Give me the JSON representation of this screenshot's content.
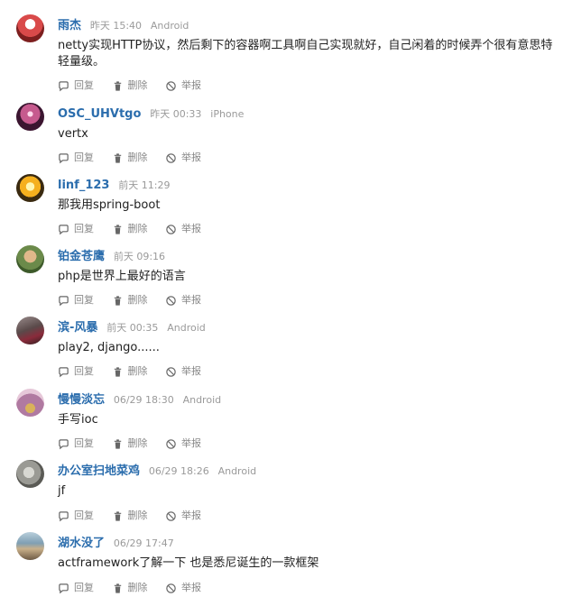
{
  "actions": {
    "reply": "回复",
    "delete": "删除",
    "report": "举报"
  },
  "comments": [
    {
      "author": "雨杰",
      "time": "昨天 15:40",
      "device": "Android",
      "content": "netty实现HTTP协议，然后剩下的容器啊工具啊自己实现就好，自己闲着的时候弄个很有意思特轻量级。"
    },
    {
      "author": "OSC_UHVtgo",
      "time": "昨天 00:33",
      "device": "iPhone",
      "content": "vertx"
    },
    {
      "author": "linf_123",
      "time": "前天 11:29",
      "device": "",
      "content": "那我用spring-boot"
    },
    {
      "author": "铂金苍鹰",
      "time": "前天 09:16",
      "device": "",
      "content": "php是世界上最好的语言"
    },
    {
      "author": "滨-风暴",
      "time": "前天 00:35",
      "device": "Android",
      "content": "play2, django......"
    },
    {
      "author": "慢慢淡忘",
      "time": "06/29 18:30",
      "device": "Android",
      "content": "手写ioc"
    },
    {
      "author": "办公室扫地菜鸡",
      "time": "06/29 18:26",
      "device": "Android",
      "content": "jf"
    },
    {
      "author": "湖水没了",
      "time": "06/29 17:47",
      "device": "",
      "content": "actframework了解一下 也是悉尼诞生的一款框架"
    }
  ],
  "avatar_colors": [
    "#c0392b",
    "#8e3a59",
    "#f5b01e",
    "#5a7a3a",
    "#7a6b6b",
    "#b07aa1",
    "#8b8b86",
    "#6d8fa3"
  ]
}
